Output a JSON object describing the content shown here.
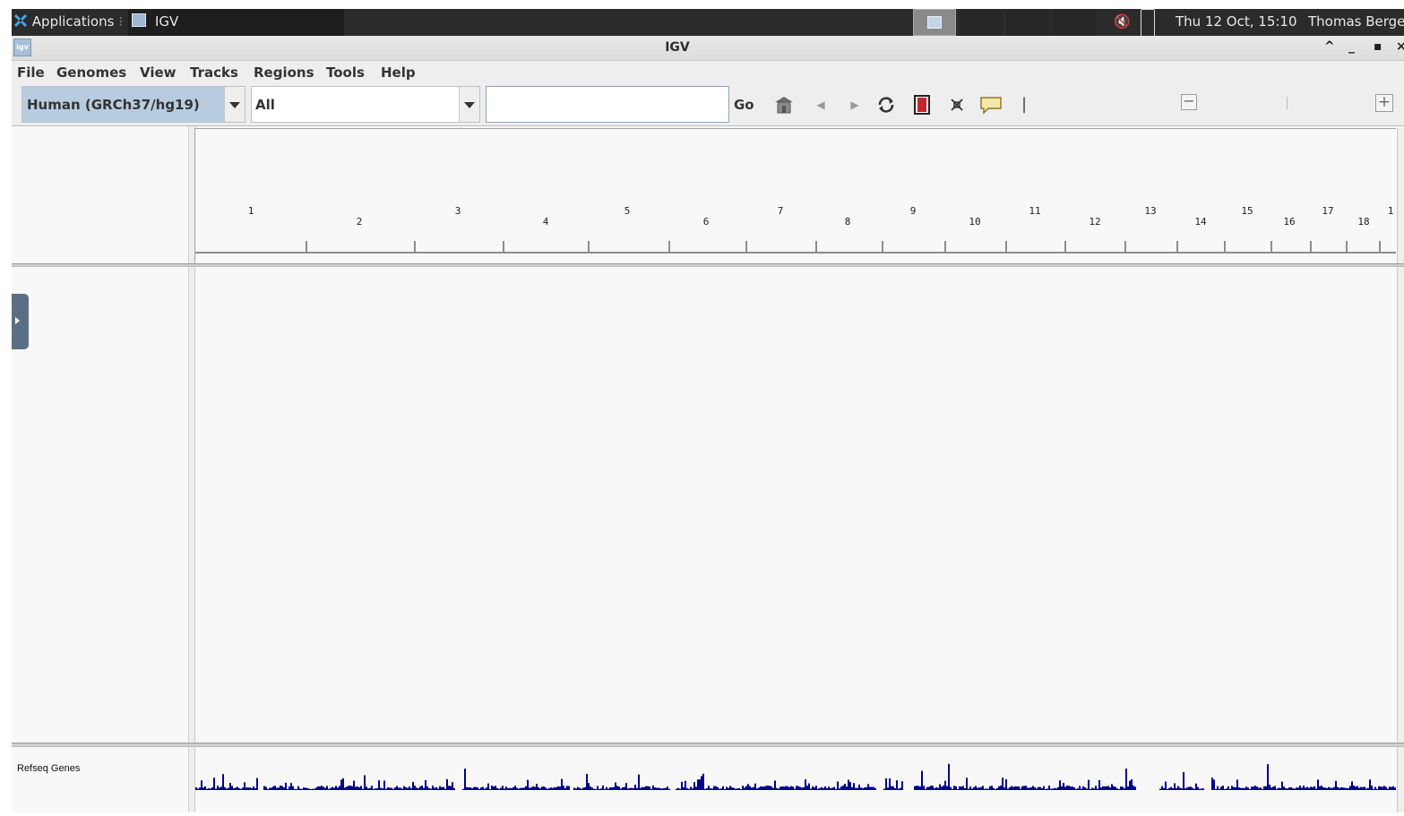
{
  "taskbar": {
    "applications_label": "Applications",
    "applications_suffix": "⁝",
    "task_label": "IGV",
    "clock": "Thu 12 Oct, 15:10",
    "user": "Thomas Berge"
  },
  "window": {
    "title": "IGV",
    "icon_text": "igv",
    "controls": {
      "shade": "^",
      "minimize": "_",
      "maximize": "▪",
      "close": "×"
    }
  },
  "menu": [
    "File",
    "Genomes",
    "View",
    "Tracks",
    "Regions",
    "Tools",
    "Help"
  ],
  "toolbar": {
    "genome": "Human (GRCh37/hg19)",
    "chromosome": "All",
    "locus_value": "",
    "go_label": "Go",
    "zoom_out": "−",
    "zoom_in": "+"
  },
  "ruler": {
    "chromosomes": [
      "1",
      "2",
      "3",
      "4",
      "5",
      "6",
      "7",
      "8",
      "9",
      "10",
      "11",
      "12",
      "13",
      "14",
      "15",
      "16",
      "17",
      "18",
      "1"
    ]
  },
  "tracks": [
    {
      "name": "Refseq Genes",
      "color": "#00008b"
    }
  ],
  "colors": {
    "taskbar_bg": "#2b2b2b",
    "panel_bg": "#f8f8f8",
    "genome_combo_bg": "#b8cce0",
    "feature_color": "#00008b"
  }
}
